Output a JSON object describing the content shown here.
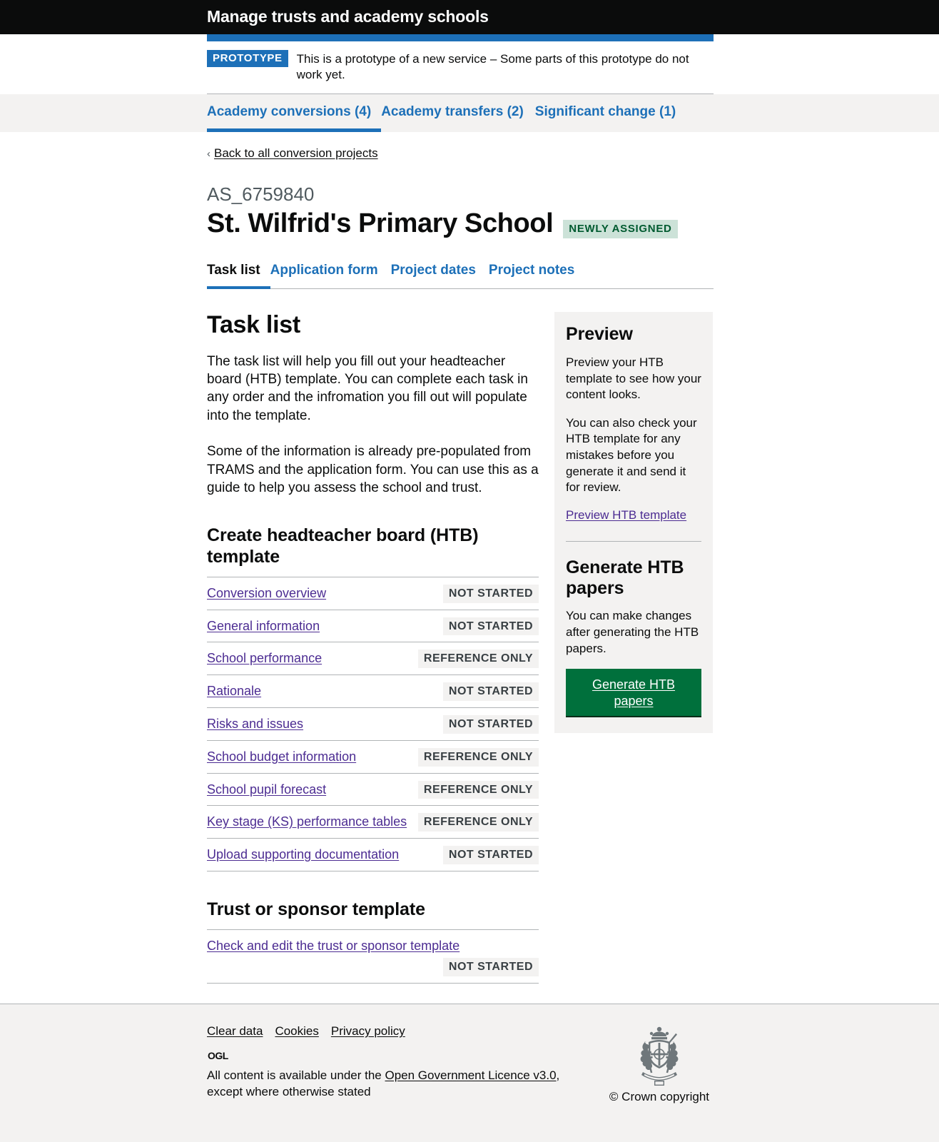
{
  "header": {
    "service_name": "Manage trusts and academy schools"
  },
  "phase_banner": {
    "tag": "PROTOTYPE",
    "text": "This is a prototype of a new service – Some parts of this prototype do not work yet."
  },
  "primary_nav": [
    {
      "label": "Academy conversions (4)",
      "current": true
    },
    {
      "label": "Academy transfers (2)",
      "current": false
    },
    {
      "label": "Significant change (1)",
      "current": false
    }
  ],
  "back_link": {
    "label": "Back to all conversion projects",
    "chevron": "chevron-left-icon"
  },
  "page": {
    "caption": "AS_6759840",
    "title": "St. Wilfrid's Primary School",
    "status_badge": "NEWLY ASSIGNED"
  },
  "sub_nav": [
    {
      "label": "Task list",
      "current": true
    },
    {
      "label": "Application form",
      "current": false
    },
    {
      "label": "Project dates",
      "current": false
    },
    {
      "label": "Project notes",
      "current": false
    }
  ],
  "main": {
    "section_title": "Task list",
    "paragraphs": [
      "The task list will help you fill out your headteacher board (HTB) template. You can complete each task in any order and the infromation you fill out will populate into the template.",
      "Some of the information is already pre-populated from TRAMS and the application form. You can use this as a guide to help you assess the school and trust."
    ],
    "htb_section_heading": "Create headteacher board (HTB) template",
    "htb_tasks": [
      {
        "label": "Conversion overview",
        "status": "NOT STARTED"
      },
      {
        "label": "General information",
        "status": "NOT STARTED"
      },
      {
        "label": "School performance",
        "status": "REFERENCE ONLY"
      },
      {
        "label": "Rationale",
        "status": "NOT STARTED"
      },
      {
        "label": "Risks and issues",
        "status": "NOT STARTED"
      },
      {
        "label": "School budget information",
        "status": "REFERENCE ONLY"
      },
      {
        "label": "School pupil forecast",
        "status": "REFERENCE ONLY"
      },
      {
        "label": "Key stage (KS) performance tables",
        "status": "REFERENCE ONLY"
      },
      {
        "label": "Upload supporting documentation",
        "status": "NOT STARTED"
      }
    ],
    "trust_section_heading": "Trust or sponsor template",
    "trust_tasks": [
      {
        "label": "Check and edit the trust or sponsor template",
        "status": "NOT STARTED"
      }
    ]
  },
  "sidebar": {
    "preview": {
      "title": "Preview",
      "paragraphs": [
        "Preview your HTB template to see how your content looks.",
        "You can also check your HTB template for any mistakes before you generate it and send it for review."
      ],
      "link": "Preview HTB template"
    },
    "generate": {
      "title": "Generate HTB papers",
      "paragraph": "You can make changes after generating the HTB papers.",
      "button": "Generate HTB papers"
    }
  },
  "footer": {
    "links": [
      "Clear data",
      "Cookies",
      "Privacy policy"
    ],
    "ogl_mark": "OGL",
    "licence_prefix": "All content is available under the ",
    "licence_link": "Open Government Licence v3.0",
    "licence_suffix": ", except where otherwise stated",
    "crown_copyright": "© Crown copyright",
    "crest_icon": "royal-crest-icon"
  },
  "colors": {
    "black": "#0b0c0c",
    "blue": "#1d70b8",
    "green_button": "#00703c",
    "badge_bg": "#cce2d8",
    "badge_text": "#005a30",
    "grey_bg": "#f3f2f1",
    "link_purple": "#4c2c92"
  }
}
